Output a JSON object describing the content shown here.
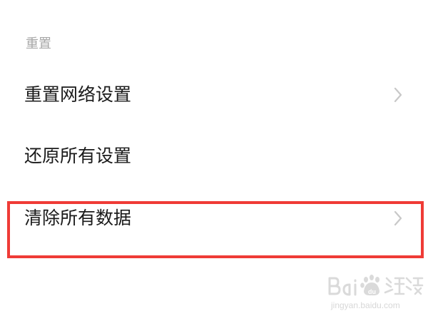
{
  "section": {
    "header": "重置"
  },
  "items": [
    {
      "label": "重置网络设置",
      "icon": "chevron-right-icon"
    },
    {
      "label": "还原所有设置"
    },
    {
      "label": "清除所有数据",
      "icon": "chevron-right-icon"
    }
  ],
  "highlight": {
    "color": "#ef3b36"
  },
  "watermark": {
    "url": "jingyan.baidu.com"
  }
}
